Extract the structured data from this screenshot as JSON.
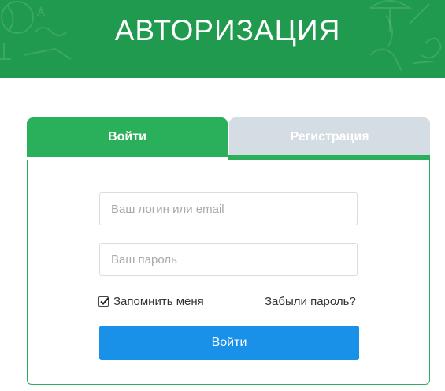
{
  "header": {
    "title": "АВТОРИЗАЦИЯ"
  },
  "tabs": [
    {
      "label": "Войти",
      "active": true
    },
    {
      "label": "Регистрация",
      "active": false
    }
  ],
  "form": {
    "login_placeholder": "Ваш логин или email",
    "login_value": "",
    "password_placeholder": "Ваш пароль",
    "password_value": "",
    "remember_label": "Запомнить меня",
    "remember_checked": true,
    "forgot_label": "Забыли пароль?",
    "submit_label": "Войти"
  },
  "colors": {
    "header_bg": "#1f9a4e",
    "active_tab": "#2ab05a",
    "inactive_tab": "#d3dde3",
    "submit_button": "#1a91e8"
  }
}
